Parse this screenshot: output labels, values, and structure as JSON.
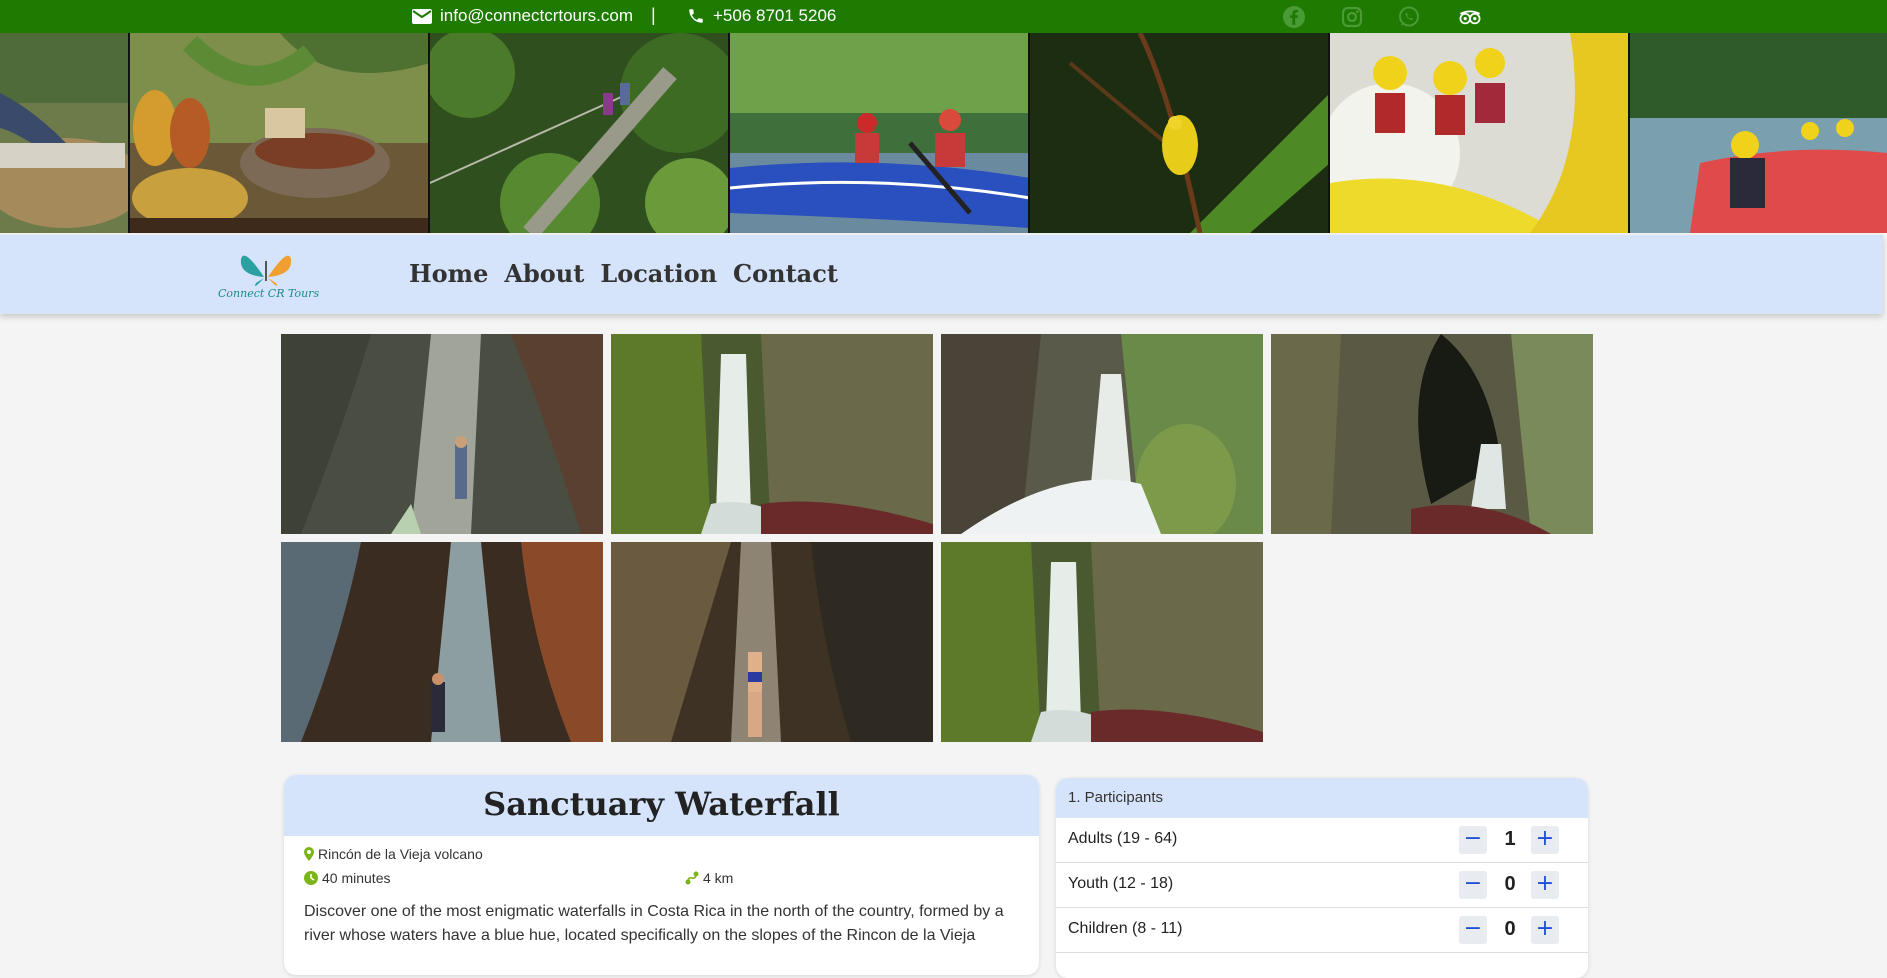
{
  "topbar": {
    "email": "info@connectcrtours.com",
    "separator": "|",
    "phone": "+506 8701 5206",
    "social_icons": [
      "facebook-icon",
      "instagram-icon",
      "whatsapp-icon",
      "tripadvisor-icon"
    ]
  },
  "brand": {
    "logo_text": "Connect CR Tours"
  },
  "nav": {
    "items": [
      "Home",
      "About",
      "Location",
      "Contact"
    ]
  },
  "tour": {
    "title": "Sanctuary Waterfall",
    "location": "Rincón de la Vieja volcano",
    "duration": "40 minutes",
    "distance": "4 km",
    "description": "Discover one of the most enigmatic waterfalls in Costa Rica in the north of the country, formed by a river whose waters have a blue hue, located specifically on the slopes of the Rincon de la Vieja"
  },
  "booking": {
    "step_title": "1. Participants",
    "rows": [
      {
        "label": "Adults (19 - 64)",
        "qty": "1"
      },
      {
        "label": "Youth (12 - 18)",
        "qty": "0"
      },
      {
        "label": "Children (8 - 11)",
        "qty": "0"
      }
    ],
    "minus": "−",
    "plus": "+"
  },
  "colors": {
    "topbar": "#1e7a00",
    "nav": "#d6e4fb",
    "accent": "#1d4ed8",
    "meta_icon": "#7cb518"
  }
}
